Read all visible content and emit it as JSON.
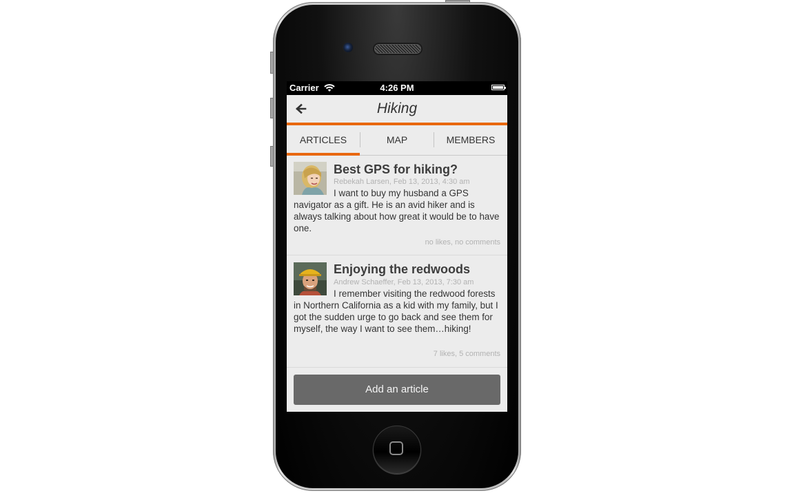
{
  "status_bar": {
    "carrier": "Carrier",
    "time": "4:26 PM"
  },
  "nav": {
    "title": "Hiking",
    "accent_color": "#e8680f"
  },
  "tabs": [
    {
      "label": "ARTICLES",
      "active": true
    },
    {
      "label": "MAP",
      "active": false
    },
    {
      "label": "MEMBERS",
      "active": false
    }
  ],
  "articles": [
    {
      "title": "Best GPS for hiking?",
      "meta": "Rebekah Larsen, Feb 13, 2013, 4:30 am",
      "body": "I want to buy my husband a GPS navigator as a gift. He is an avid hiker and is always talking about how great it would be to have one.",
      "stats": "no likes, no comments"
    },
    {
      "title": "Enjoying the redwoods",
      "meta": "Andrew Schaeffer, Feb 13, 2013, 7:30 am",
      "body": "I remember visiting the redwood forests in Northern California as a kid with my family, but I got the sudden urge to go back and see them for myself, the way I want to see them…hiking!",
      "stats": "7 likes, 5 comments"
    }
  ],
  "add_button": {
    "label": "Add an article"
  }
}
